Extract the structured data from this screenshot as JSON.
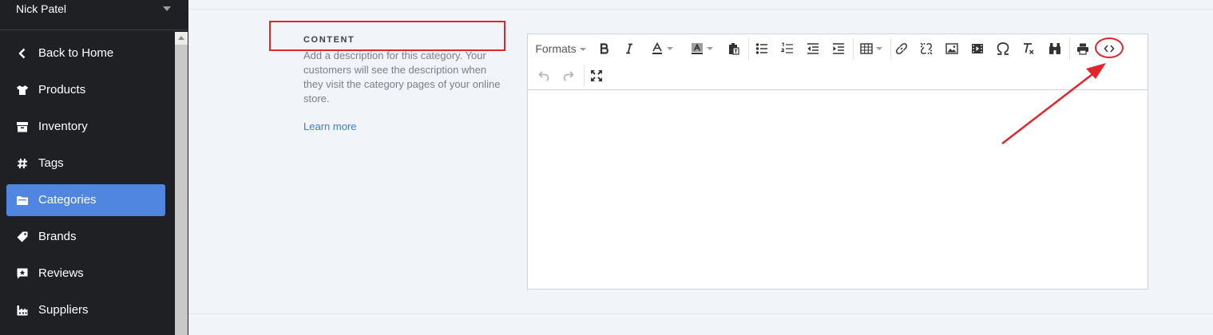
{
  "user": {
    "name": "Nick Patel"
  },
  "sidebar": {
    "items": [
      {
        "label": "Back to Home",
        "icon": "chevron-left-icon",
        "active": false
      },
      {
        "label": "Products",
        "icon": "tshirt-icon",
        "active": false
      },
      {
        "label": "Inventory",
        "icon": "archive-icon",
        "active": false
      },
      {
        "label": "Tags",
        "icon": "hash-icon",
        "active": false
      },
      {
        "label": "Categories",
        "icon": "folder-icon",
        "active": true
      },
      {
        "label": "Brands",
        "icon": "tag-icon",
        "active": false
      },
      {
        "label": "Reviews",
        "icon": "star-comment-icon",
        "active": false
      },
      {
        "label": "Suppliers",
        "icon": "industry-icon",
        "active": false
      }
    ]
  },
  "content": {
    "heading": "CONTENT",
    "description": "Add a description for this category. Your customers will see the description when they visit the category pages of your online store.",
    "learn_more": "Learn more"
  },
  "editor": {
    "formats_label": "Formats",
    "toolbar_icons": [
      "bold-icon",
      "italic-icon",
      "text-color-icon",
      "background-color-icon",
      "paste-text-icon",
      "bullet-list-icon",
      "numbered-list-icon",
      "outdent-icon",
      "indent-icon",
      "table-icon",
      "link-icon",
      "unlink-icon",
      "image-icon",
      "media-icon",
      "special-character-icon",
      "clear-formatting-icon",
      "find-replace-icon",
      "print-icon",
      "source-code-icon",
      "undo-icon",
      "redo-icon",
      "fullscreen-icon"
    ],
    "body_text": ""
  },
  "colors": {
    "sidebar_bg": "#1e2023",
    "active": "#5086e0",
    "annotation": "#e0252b",
    "link": "#3d7bd4"
  }
}
